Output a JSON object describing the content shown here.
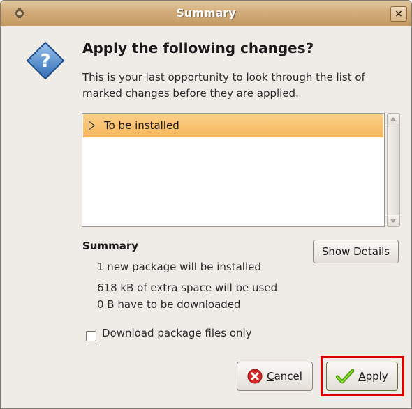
{
  "window": {
    "title": "Summary",
    "close_glyph": "×"
  },
  "dialog": {
    "heading": "Apply the following changes?",
    "description": "This is your last opportunity to look through the list of marked changes before they are applied."
  },
  "changes_list": {
    "rows": [
      {
        "label": "To be installed",
        "expanded": false,
        "selected": true
      }
    ]
  },
  "summary": {
    "title": "Summary",
    "lines": [
      "1 new package will be installed",
      "618 kB of extra space will be used",
      "0  B have to be downloaded"
    ],
    "details_button": {
      "mnemonic": "S",
      "rest": "how Details"
    }
  },
  "options": {
    "download_only_label": "Download package files only",
    "download_only_checked": false
  },
  "buttons": {
    "cancel": {
      "mnemonic": "C",
      "rest": "ancel",
      "icon": "cancel-icon"
    },
    "apply": {
      "mnemonic": "A",
      "rest": "pply",
      "icon": "check-icon",
      "highlighted": true
    }
  },
  "colors": {
    "highlight_outline": "#e00000",
    "selection": "#f6b65c",
    "titlebar": "#d2ac7b"
  }
}
